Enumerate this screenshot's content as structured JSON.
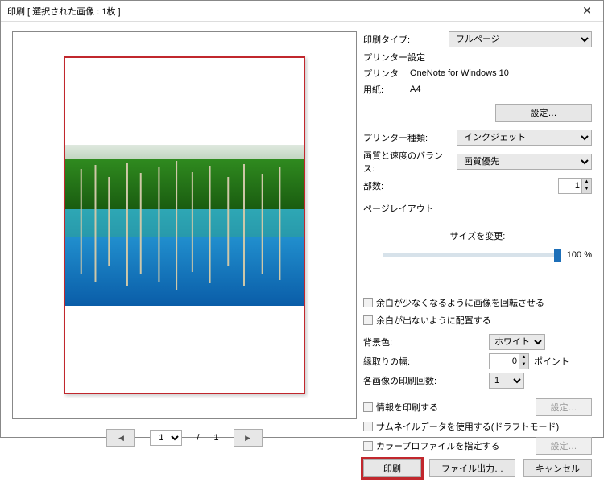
{
  "window": {
    "title": "印刷 [ 選択された画像 : 1枚 ]"
  },
  "pager": {
    "current": "1",
    "sep": "/",
    "total": "1"
  },
  "labels": {
    "printType": "印刷タイプ:",
    "printerSettings": "プリンター設定",
    "printer": "プリンタ",
    "paper": "用紙:",
    "settingsBtn": "設定…",
    "printerKind": "プリンター種類:",
    "qualitySpeed": "画質と速度のバランス:",
    "copies": "部数:",
    "pageLayout": "ページレイアウト",
    "resize": "サイズを変更:",
    "sizePercent": "100 %",
    "rotateCheckbox": "余白が少なくなるように画像を回転させる",
    "tileCheckbox": "余白が出ないように配置する",
    "bgColor": "背景色:",
    "borderWidth": "縁取りの幅:",
    "pointUnit": "ポイント",
    "perImageCopies": "各画像の印刷回数:",
    "printInfo": "情報を印刷する",
    "useThumbnail": "サムネイルデータを使用する(ドラフトモード)",
    "specifyProfile": "カラープロファイルを指定する",
    "settingsBtn2": "設定…",
    "settingsBtn3": "設定…"
  },
  "values": {
    "printType": "フルページ",
    "printerName": "OneNote for Windows 10",
    "paper": "A4",
    "printerKind": "インクジェット",
    "quality": "画質優先",
    "copies": "1",
    "bgColor": "ホワイト",
    "borderWidth": "0",
    "perImageCopies": "1"
  },
  "footer": {
    "print": "印刷",
    "fileOutput": "ファイル出力…",
    "cancel": "キャンセル"
  }
}
